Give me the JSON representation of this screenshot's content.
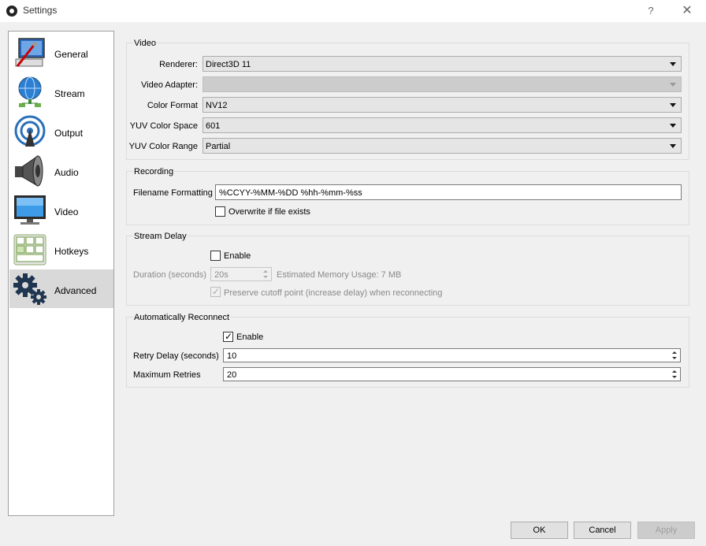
{
  "window": {
    "title": "Settings",
    "help": "?",
    "close": "✕"
  },
  "sidebar": {
    "items": [
      {
        "label": "General",
        "icon": "general-icon"
      },
      {
        "label": "Stream",
        "icon": "stream-icon"
      },
      {
        "label": "Output",
        "icon": "output-icon"
      },
      {
        "label": "Audio",
        "icon": "audio-icon"
      },
      {
        "label": "Video",
        "icon": "video-icon"
      },
      {
        "label": "Hotkeys",
        "icon": "hotkeys-icon"
      },
      {
        "label": "Advanced",
        "icon": "advanced-icon",
        "active": true
      }
    ]
  },
  "video": {
    "title": "Video",
    "renderer_label": "Renderer:",
    "renderer_value": "Direct3D 11",
    "adapter_label": "Video Adapter:",
    "adapter_value": "",
    "color_format_label": "Color Format",
    "color_format_value": "NV12",
    "yuv_space_label": "YUV Color Space",
    "yuv_space_value": "601",
    "yuv_range_label": "YUV Color Range",
    "yuv_range_value": "Partial"
  },
  "recording": {
    "title": "Recording",
    "filename_label": "Filename Formatting",
    "filename_value": "%CCYY-%MM-%DD %hh-%mm-%ss",
    "overwrite_label": "Overwrite if file exists",
    "overwrite_checked": false
  },
  "stream_delay": {
    "title": "Stream Delay",
    "enable_label": "Enable",
    "enable_checked": false,
    "duration_label": "Duration (seconds)",
    "duration_value": "20s",
    "memory_label": "Estimated Memory Usage: 7 MB",
    "preserve_label": "Preserve cutoff point (increase delay) when reconnecting",
    "preserve_checked": true
  },
  "reconnect": {
    "title": "Automatically Reconnect",
    "enable_label": "Enable",
    "enable_checked": true,
    "retry_delay_label": "Retry Delay (seconds)",
    "retry_delay_value": "10",
    "max_retries_label": "Maximum Retries",
    "max_retries_value": "20"
  },
  "buttons": {
    "ok": "OK",
    "cancel": "Cancel",
    "apply": "Apply"
  },
  "colors": {
    "active_nav_bg": "#d9d9d9",
    "window_bg": "#f0f0f0",
    "panel_border": "#dcdcdc"
  }
}
